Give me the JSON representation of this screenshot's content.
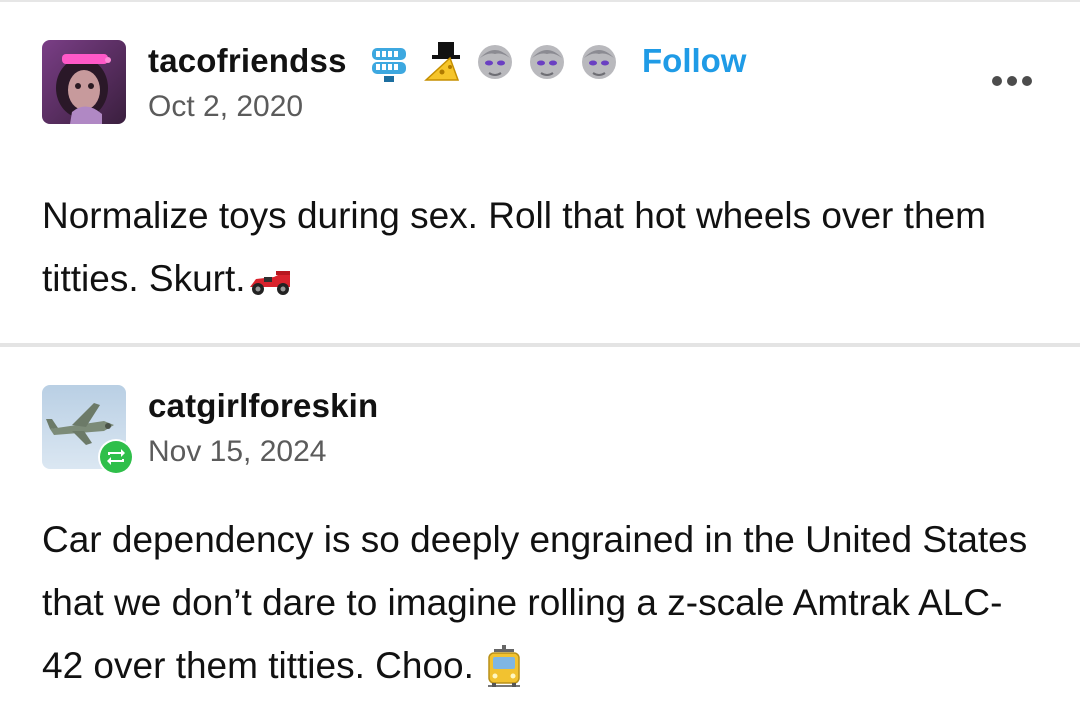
{
  "posts": [
    {
      "username": "tacofriendss",
      "date": "Oct 2, 2020",
      "follow_label": "Follow",
      "badges": [
        "chattering-teeth-icon",
        "cheese-top-hat-icon",
        "statue-head-icon",
        "statue-head-icon",
        "statue-head-icon"
      ],
      "text": "Normalize toys during sex. Roll that hot wheels over them titties. Skurt.",
      "trailing_emoji": "racing-car-icon"
    },
    {
      "username": "catgirlforeskin",
      "date": "Nov 15, 2024",
      "reblog_icon": "reblog-icon",
      "text": "Car dependency is so deeply engrained in the United States that we don’t dare to imagine rolling a z-scale Amtrak ALC-42 over them titties. Choo.",
      "trailing_emoji": "tram-icon"
    }
  ],
  "colors": {
    "follow": "#1f9be6",
    "reblog_green": "#2fbf4a",
    "date_gray": "#5b5b5b"
  }
}
